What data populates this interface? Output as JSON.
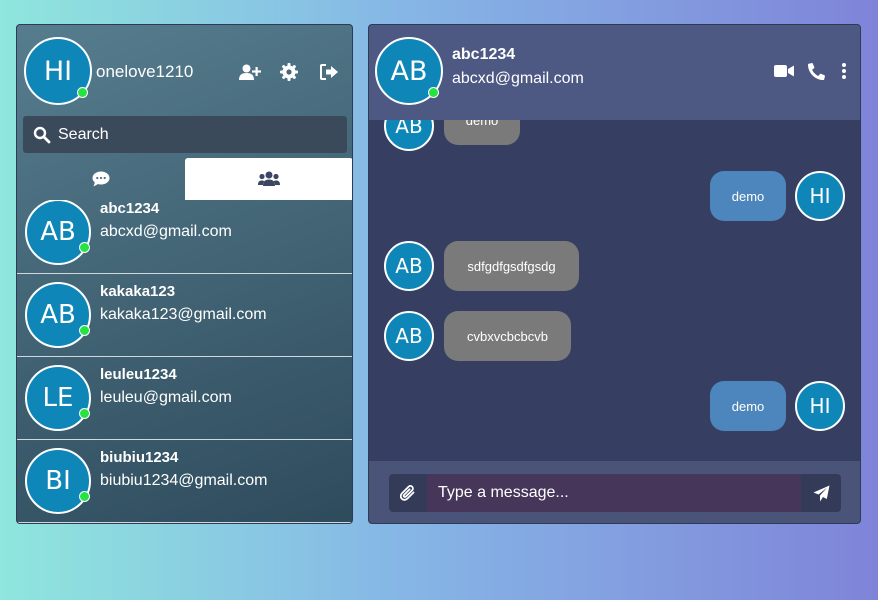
{
  "me": {
    "initials": "HI",
    "username": "onelove1210"
  },
  "header_icons": [
    "add-user-icon",
    "gear-icon",
    "sign-out-icon"
  ],
  "search": {
    "label": "Search"
  },
  "tabs": [
    "chat-bubble-icon",
    "users-icon"
  ],
  "contacts": [
    {
      "initials": "AB",
      "name": "abc1234",
      "email": "abcxd@gmail.com"
    },
    {
      "initials": "AB",
      "name": "kakaka123",
      "email": "kakaka123@gmail.com"
    },
    {
      "initials": "LE",
      "name": "leuleu1234",
      "email": "leuleu@gmail.com"
    },
    {
      "initials": "BI",
      "name": "biubiu1234",
      "email": "biubiu1234@gmail.com"
    }
  ],
  "chat": {
    "initials": "AB",
    "name": "abc1234",
    "email": "abcxd@gmail.com",
    "action_icons": [
      "video-icon",
      "phone-icon",
      "more-vertical-icon"
    ]
  },
  "messages": [
    {
      "from": "them",
      "initials": "AB",
      "text": "demo"
    },
    {
      "from": "me",
      "initials": "HI",
      "text": "demo"
    },
    {
      "from": "them",
      "initials": "AB",
      "text": "sdfgdfgsdfgsdg"
    },
    {
      "from": "them",
      "initials": "AB",
      "text": "cvbxvcbcbcvb"
    },
    {
      "from": "me",
      "initials": "HI",
      "text": "demo"
    }
  ],
  "composer": {
    "placeholder": "Type a message..."
  },
  "colors": {
    "avatar": "#0f86b8",
    "online": "#27e342",
    "bubble_in": "#7a7a7a",
    "bubble_out": "#4d86bc"
  }
}
